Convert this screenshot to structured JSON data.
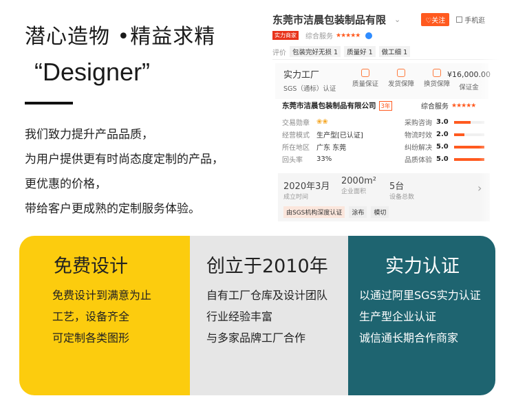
{
  "intro": {
    "slogan": "潜心造物 •精益求精",
    "designer": "“Designer”",
    "paragraph": [
      "我们致力提升产品品质，",
      "为用户提供更有时尚态度定制的产品，",
      "更优惠的价格，",
      "带给客户更成熟的定制服务体验。"
    ]
  },
  "store": {
    "name": "东莞市洁晨包装制品有限",
    "chevron": "⌄",
    "follow_label": "♡关注",
    "phone_label": "手机逛",
    "badge": "实力商家",
    "rating_label": "综合服务",
    "rating_stars": "★★★★★",
    "review_label": "评价",
    "review_tags": [
      "包装完好无损 1",
      "质量好 1",
      "做工细 1"
    ],
    "factory_title": "实力工厂",
    "factory_sub": "SGS（通标）认证",
    "guarantees": [
      "质量保证",
      "发货保障",
      "换货保障"
    ],
    "deposit_amount": "¥16,000.00",
    "deposit_label": "保证金",
    "company": "东莞市洁晨包装制品有限公司",
    "years": "3年",
    "overall_label": "综合服务",
    "overall_stars": "★★★★★",
    "details": [
      {
        "k": "交易勋章",
        "v": "❀❀"
      },
      {
        "k": "经营模式",
        "v": "生产型[已认证]"
      },
      {
        "k": "所在地区",
        "v": "广东 东莞"
      },
      {
        "k": "回头率",
        "v": "33%"
      }
    ],
    "scores": [
      {
        "label": "采购咨询",
        "value": "3.0",
        "fill": 0.55
      },
      {
        "label": "物流时效",
        "value": "2.0",
        "fill": 0.35
      },
      {
        "label": "纠纷解决",
        "value": "5.0",
        "fill": 1.0
      },
      {
        "label": "品质体验",
        "value": "5.0",
        "fill": 1.0
      }
    ],
    "info": [
      {
        "big": "2020年3月",
        "small": "成立时间"
      },
      {
        "big": "2000m²",
        "small": "企业面积"
      },
      {
        "big": "5台",
        "small": "设备总数"
      }
    ],
    "info_arrow": "›",
    "chips": [
      "由SGS机构深度认证",
      "涂布",
      "模切"
    ]
  },
  "cards": [
    {
      "title": "免费设计",
      "lines": [
        "免费设计到满意为止",
        "工艺，设备齐全",
        "可定制各类图形"
      ]
    },
    {
      "title": "创立于2010年",
      "lines": [
        "自有工厂仓库及设计团队",
        "行业经验丰富",
        "与多家品牌工厂合作"
      ]
    },
    {
      "title": "实力认证",
      "lines": [
        "以通过阿里SGS实力认证",
        "生产型企业认证",
        "诚信通长期合作商家"
      ]
    }
  ],
  "colors": {
    "card1": "#fccc0e",
    "card2": "#e6e6e6",
    "card3": "#1e6470",
    "accent": "#ff5a1f"
  }
}
